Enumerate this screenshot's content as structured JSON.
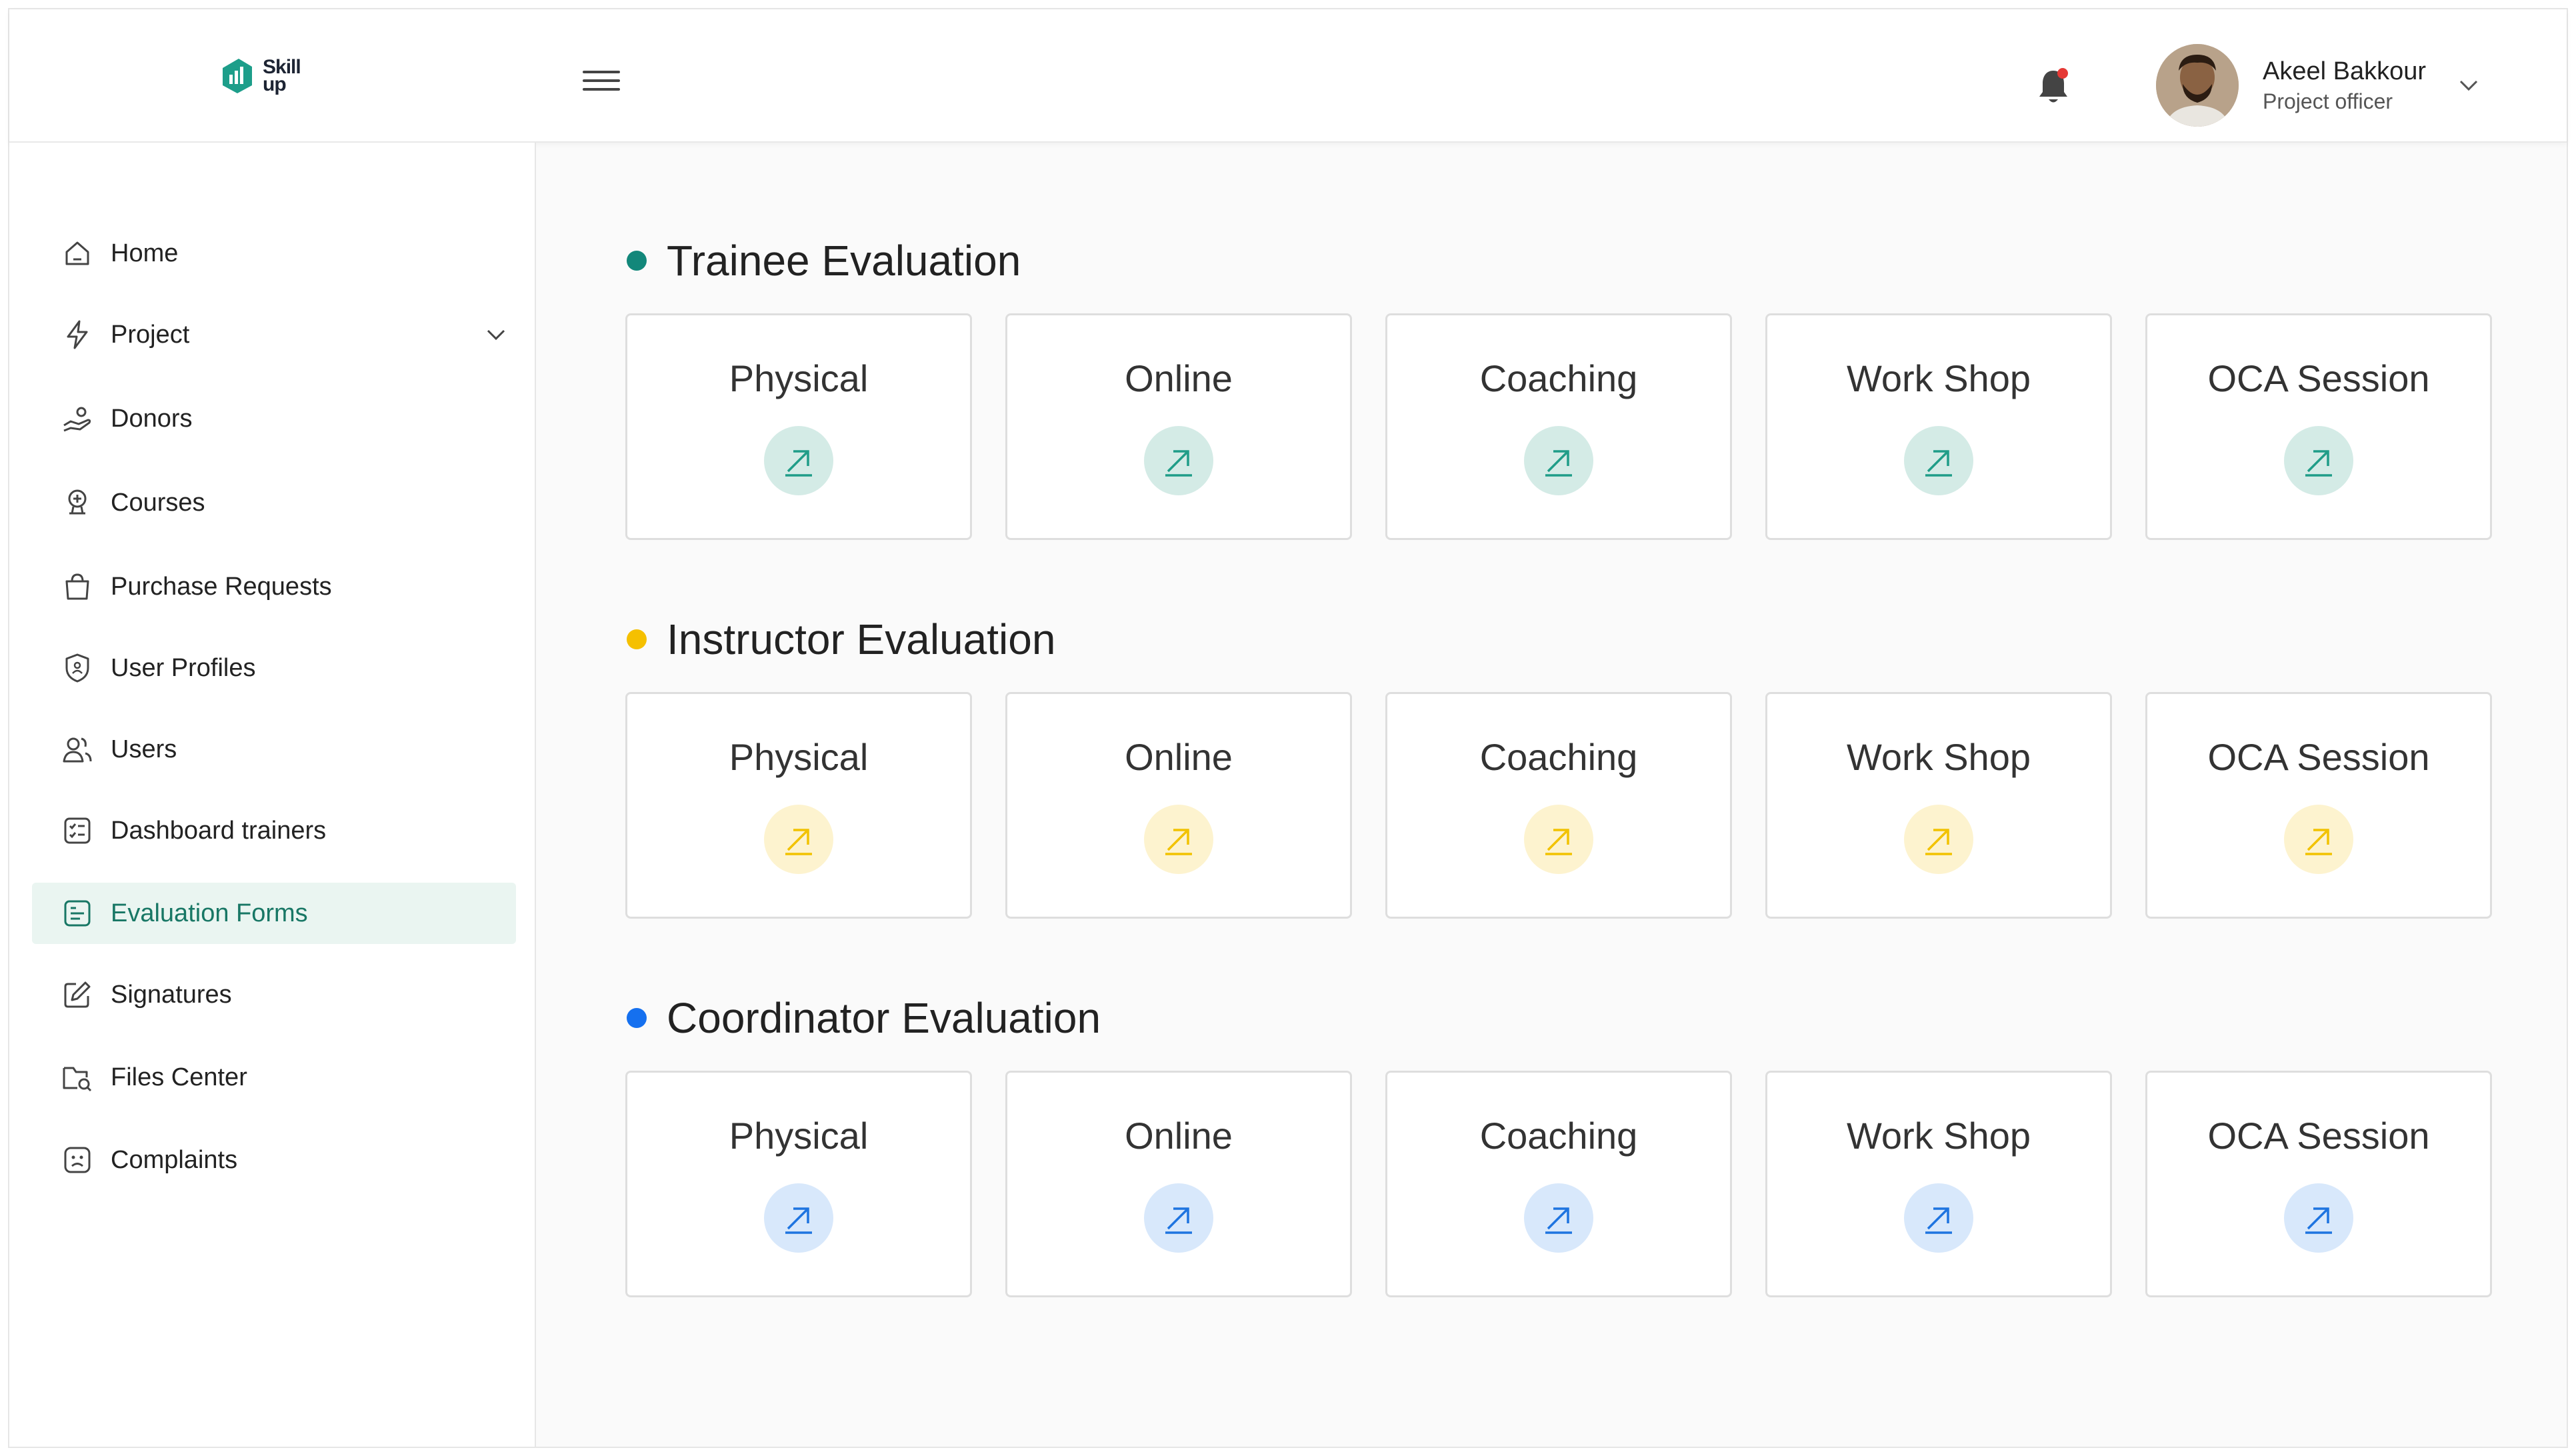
{
  "brand": {
    "logo_text_top": "Skill",
    "logo_text_bottom": "up",
    "color": "#1d9e8a"
  },
  "header": {
    "user_name": "Akeel Bakkour",
    "user_role": "Project officer",
    "notification_dot_color": "#e53935"
  },
  "sidebar": {
    "items": [
      {
        "label": "Home",
        "icon": "home-icon"
      },
      {
        "label": "Project",
        "icon": "bolt-icon",
        "expandable": true
      },
      {
        "label": "Donors",
        "icon": "donors-hand-icon"
      },
      {
        "label": "Courses",
        "icon": "courses-icon"
      },
      {
        "label": "Purchase Requests",
        "icon": "shopping-bag-icon"
      },
      {
        "label": "User Profiles",
        "icon": "shield-user-icon"
      },
      {
        "label": "Users",
        "icon": "users-icon"
      },
      {
        "label": "Dashboard trainers",
        "icon": "dashboard-list-icon"
      },
      {
        "label": "Evaluation Forms",
        "icon": "evaluation-form-icon",
        "active": true
      },
      {
        "label": "Signatures",
        "icon": "signature-edit-icon"
      },
      {
        "label": "Files Center",
        "icon": "folder-icon"
      },
      {
        "label": "Complaints",
        "icon": "complaint-face-icon"
      }
    ],
    "active_color": "#187765",
    "active_bg": "#eaf5f1"
  },
  "sections": [
    {
      "title": "Trainee Evaluation",
      "dot_color": "#12877a",
      "btn_bg": "#d4ebe6",
      "arrow_color": "#1f9d88",
      "cards": [
        "Physical",
        "Online",
        "Coaching",
        "Work Shop",
        "OCA Session"
      ]
    },
    {
      "title": "Instructor Evaluation",
      "dot_color": "#f5c000",
      "btn_bg": "#fdf3cf",
      "arrow_color": "#f2c200",
      "cards": [
        "Physical",
        "Online",
        "Coaching",
        "Work Shop",
        "OCA Session"
      ]
    },
    {
      "title": "Coordinator Evaluation",
      "dot_color": "#1570ef",
      "btn_bg": "#d8e8fb",
      "arrow_color": "#1e74e0",
      "cards": [
        "Physical",
        "Online",
        "Coaching",
        "Work Shop",
        "OCA Session"
      ]
    }
  ]
}
